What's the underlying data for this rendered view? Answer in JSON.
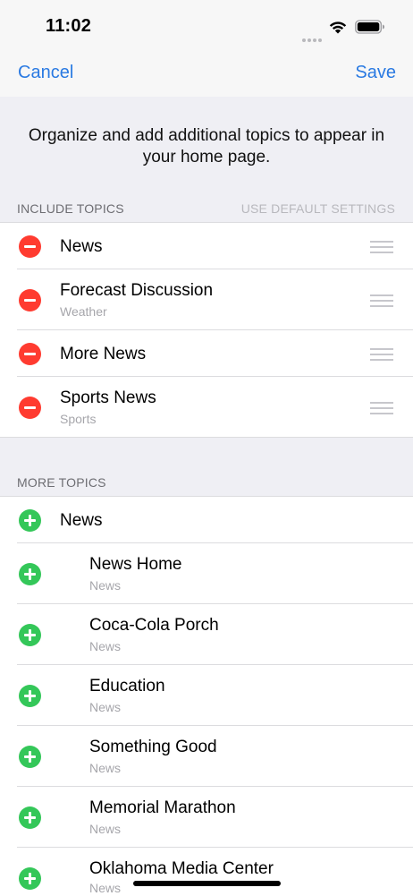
{
  "status_bar": {
    "time": "11:02",
    "icons": [
      "signal-dots-icon",
      "wifi-icon",
      "battery-icon"
    ]
  },
  "nav": {
    "cancel_label": "Cancel",
    "save_label": "Save",
    "accent_color": "#2a7ae2"
  },
  "intro": {
    "text": "Organize and add additional topics to appear in your home page."
  },
  "include_topics": {
    "header": "INCLUDE TOPICS",
    "action": "USE DEFAULT SETTINGS",
    "remove_color": "#ff3b30",
    "items": [
      {
        "title": "News",
        "subtitle": ""
      },
      {
        "title": "Forecast Discussion",
        "subtitle": "Weather"
      },
      {
        "title": "More News",
        "subtitle": ""
      },
      {
        "title": "Sports News",
        "subtitle": "Sports"
      }
    ]
  },
  "more_topics": {
    "header": "MORE TOPICS",
    "add_color": "#34c759",
    "items": [
      {
        "title": "News",
        "subtitle": ""
      },
      {
        "title": "News Home",
        "subtitle": "News"
      },
      {
        "title": "Coca-Cola Porch",
        "subtitle": "News"
      },
      {
        "title": "Education",
        "subtitle": "News"
      },
      {
        "title": "Something Good",
        "subtitle": "News"
      },
      {
        "title": "Memorial Marathon",
        "subtitle": "News"
      },
      {
        "title": "Oklahoma Media Center",
        "subtitle": "News"
      }
    ]
  }
}
